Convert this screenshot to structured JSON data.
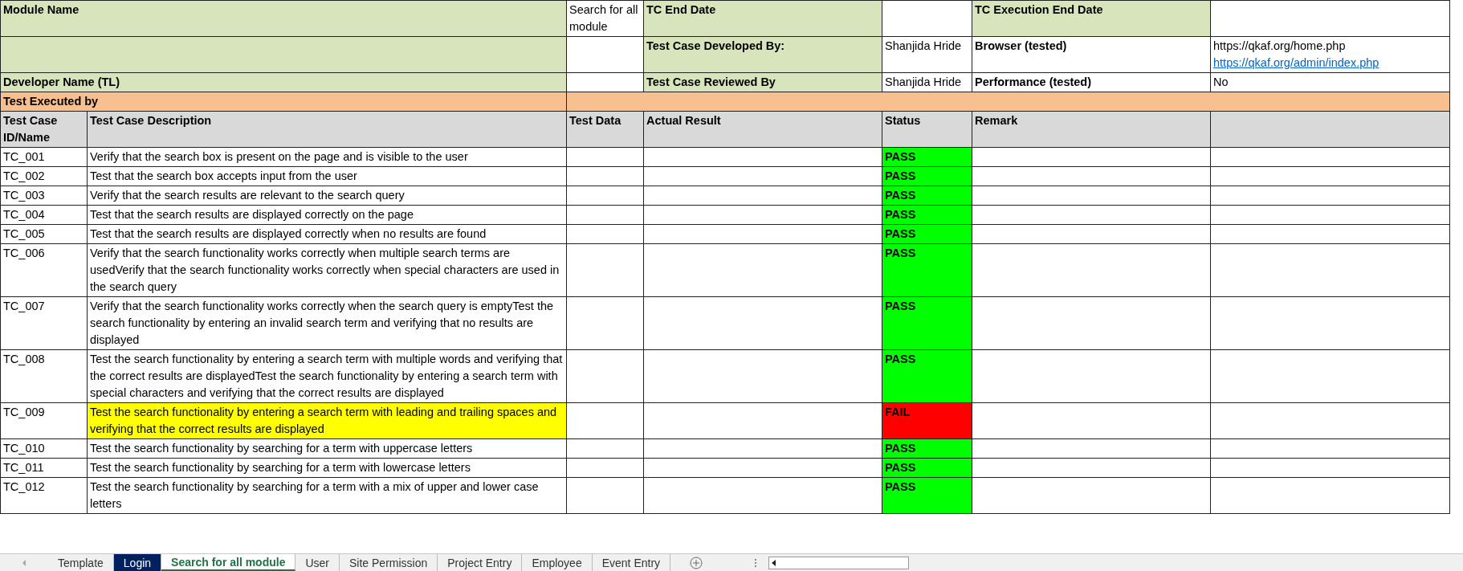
{
  "info": {
    "module_name_label": "Module Name",
    "module_name": "Search for all module",
    "tc_end_date_label": "TC End Date",
    "tc_execution_end_date_label": "TC Execution End Date",
    "developed_by_label": "Test Case Developed By:",
    "developed_by": "Shanjida Hride",
    "browser_label": "Browser (tested)",
    "browser_urls": [
      {
        "text": "https://qkaf.org/home.php",
        "link": false
      },
      {
        "text": "https://qkaf.org/admin/index.php",
        "link": true
      }
    ],
    "developer_name_label": "Developer Name (TL)",
    "reviewed_by_label": "Test Case Reviewed By",
    "reviewed_by": "Shanjida Hride",
    "performance_label": "Performance (tested)",
    "performance": "No",
    "executed_by_label": "Test Executed by"
  },
  "table": {
    "columns": [
      "Test Case ID/Name",
      "Test Case Description",
      "Test Data",
      "Actual Result",
      "Status",
      "Remark"
    ],
    "rows": [
      {
        "id": "TC_001",
        "description": "Verify that the search box is present on the page and is visible to the user",
        "highlighted": false,
        "status": "PASS",
        "color": "#00ff00"
      },
      {
        "id": "TC_002",
        "description": "Test that the search box accepts input from the user",
        "highlighted": false,
        "status": "PASS",
        "color": "#00ff00"
      },
      {
        "id": "TC_003",
        "description": "Verify that the search results are relevant to the search query",
        "highlighted": false,
        "status": "PASS",
        "color": "#00ff00"
      },
      {
        "id": "TC_004",
        "description": "Test that the search results are displayed correctly on the page",
        "highlighted": false,
        "status": "PASS",
        "color": "#00ff00"
      },
      {
        "id": "TC_005",
        "description": "Test that the search results are displayed correctly when no results are found",
        "highlighted": false,
        "status": "PASS",
        "color": "#00ff00"
      },
      {
        "id": "TC_006",
        "description": "Verify that the search functionality works correctly when multiple search terms are usedVerify that the search functionality works correctly when special characters are used in the search query",
        "highlighted": false,
        "status": "PASS",
        "color": "#00ff00"
      },
      {
        "id": "TC_007",
        "description": "Verify that the search functionality works correctly when the search query is emptyTest the search functionality by entering an invalid search term and verifying that no results are displayed",
        "highlighted": false,
        "status": "PASS",
        "color": "#00ff00"
      },
      {
        "id": "TC_008",
        "description": "Test the search functionality by entering a search term with multiple words and verifying that the correct results are displayedTest the search functionality by entering a search term with special characters and verifying that the correct results are displayed",
        "highlighted": false,
        "status": "PASS",
        "color": "#00ff00"
      },
      {
        "id": "TC_009",
        "description": "Test the search functionality by entering a search term with leading and trailing spaces and verifying that the correct results are displayed",
        "highlighted": true,
        "status": "FAIL",
        "color": "#ff0000"
      },
      {
        "id": "TC_010",
        "description": "Test the search functionality by searching for a term with uppercase letters",
        "highlighted": false,
        "status": "PASS",
        "color": "#00ff00"
      },
      {
        "id": "TC_011",
        "description": "Test the search functionality by searching for a term with lowercase letters",
        "highlighted": false,
        "status": "PASS",
        "color": "#00ff00"
      },
      {
        "id": "TC_012",
        "description": "Test the search functionality by searching for a term with a mix of upper and lower case letters",
        "highlighted": false,
        "status": "PASS",
        "color": "#00ff00"
      }
    ]
  },
  "tabs": [
    {
      "label": "Template",
      "selected": false
    },
    {
      "label": "Login",
      "selected": false,
      "color": "#002060"
    },
    {
      "label": "Search for all module",
      "selected": true
    },
    {
      "label": "User",
      "selected": false
    },
    {
      "label": "Site Permission",
      "selected": false
    },
    {
      "label": "Project Entry",
      "selected": false
    },
    {
      "label": "Employee",
      "selected": false
    },
    {
      "label": "Event Entry",
      "selected": false
    }
  ]
}
